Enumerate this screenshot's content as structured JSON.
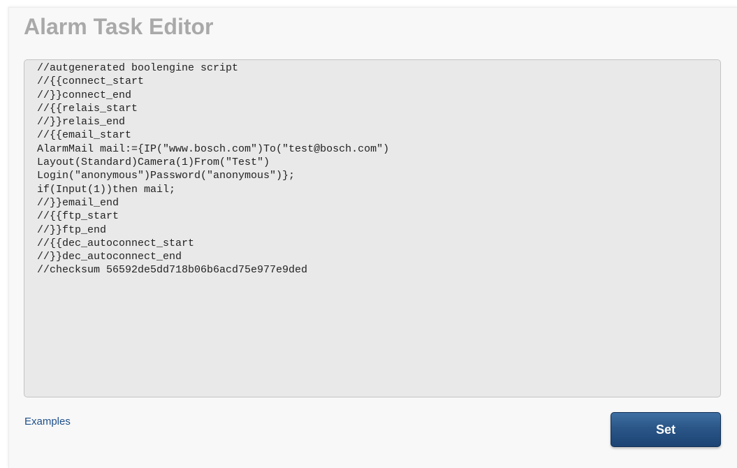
{
  "page": {
    "title": "Alarm Task Editor"
  },
  "editor": {
    "script": "//autgenerated boolengine script\n//{{connect_start\n//}}connect_end\n//{{relais_start\n//}}relais_end\n//{{email_start\nAlarmMail mail:={IP(\"www.bosch.com\")To(\"test@bosch.com\")\nLayout(Standard)Camera(1)From(\"Test\")\nLogin(\"anonymous\")Password(\"anonymous\")};\nif(Input(1))then mail;\n//}}email_end\n//{{ftp_start\n//}}ftp_end\n//{{dec_autoconnect_start\n//}}dec_autoconnect_end\n//checksum 56592de5dd718b06b6acd75e977e9ded"
  },
  "footer": {
    "examples_label": "Examples",
    "set_label": "Set"
  },
  "colors": {
    "title": "#a9a9a9",
    "link": "#1f4f8a",
    "button": "#2a5687",
    "editor_bg": "#e9e9e9"
  }
}
